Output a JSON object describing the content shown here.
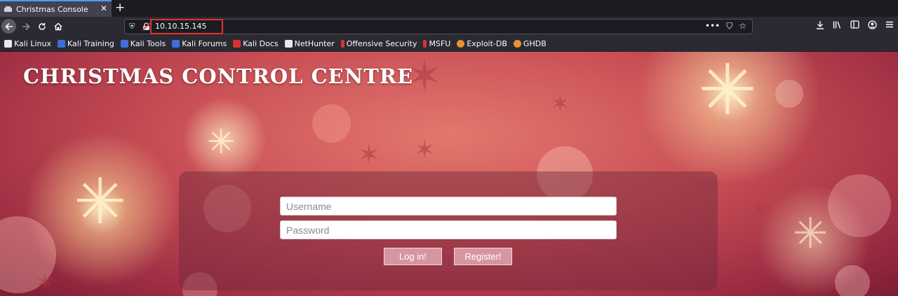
{
  "browser": {
    "tab_title": "Christmas Console",
    "new_tab": "+",
    "tab_close": "✕",
    "url": "10.10.15.145",
    "url_actions": [
      "•••",
      "⛉",
      "☆"
    ],
    "toolbar_icons": [
      "download-icon",
      "library-icon",
      "sidebar-icon",
      "account-icon",
      "menu-icon"
    ],
    "bookmarks": [
      {
        "label": "Kali Linux",
        "color": "#e8e8ee"
      },
      {
        "label": "Kali Training",
        "color": "#3d6fd8"
      },
      {
        "label": "Kali Tools",
        "color": "#3d6fd8"
      },
      {
        "label": "Kali Forums",
        "color": "#3d6fd8"
      },
      {
        "label": "Kali Docs",
        "color": "#d8332d"
      },
      {
        "label": "NetHunter",
        "color": "#e8e8ee"
      },
      {
        "label": "Offensive Security",
        "color": "#d8332d"
      },
      {
        "label": "MSFU",
        "color": "#d8332d"
      },
      {
        "label": "Exploit-DB",
        "color": "#e8912e"
      },
      {
        "label": "GHDB",
        "color": "#e8912e"
      }
    ]
  },
  "page": {
    "title": "CHRISTMAS CONTROL CENTRE",
    "username_placeholder": "Username",
    "password_placeholder": "Password",
    "login_label": "Log in!",
    "register_label": "Register!"
  },
  "colors": {
    "accent_tab": "#4c9bf5",
    "url_highlight": "#e0352b"
  }
}
